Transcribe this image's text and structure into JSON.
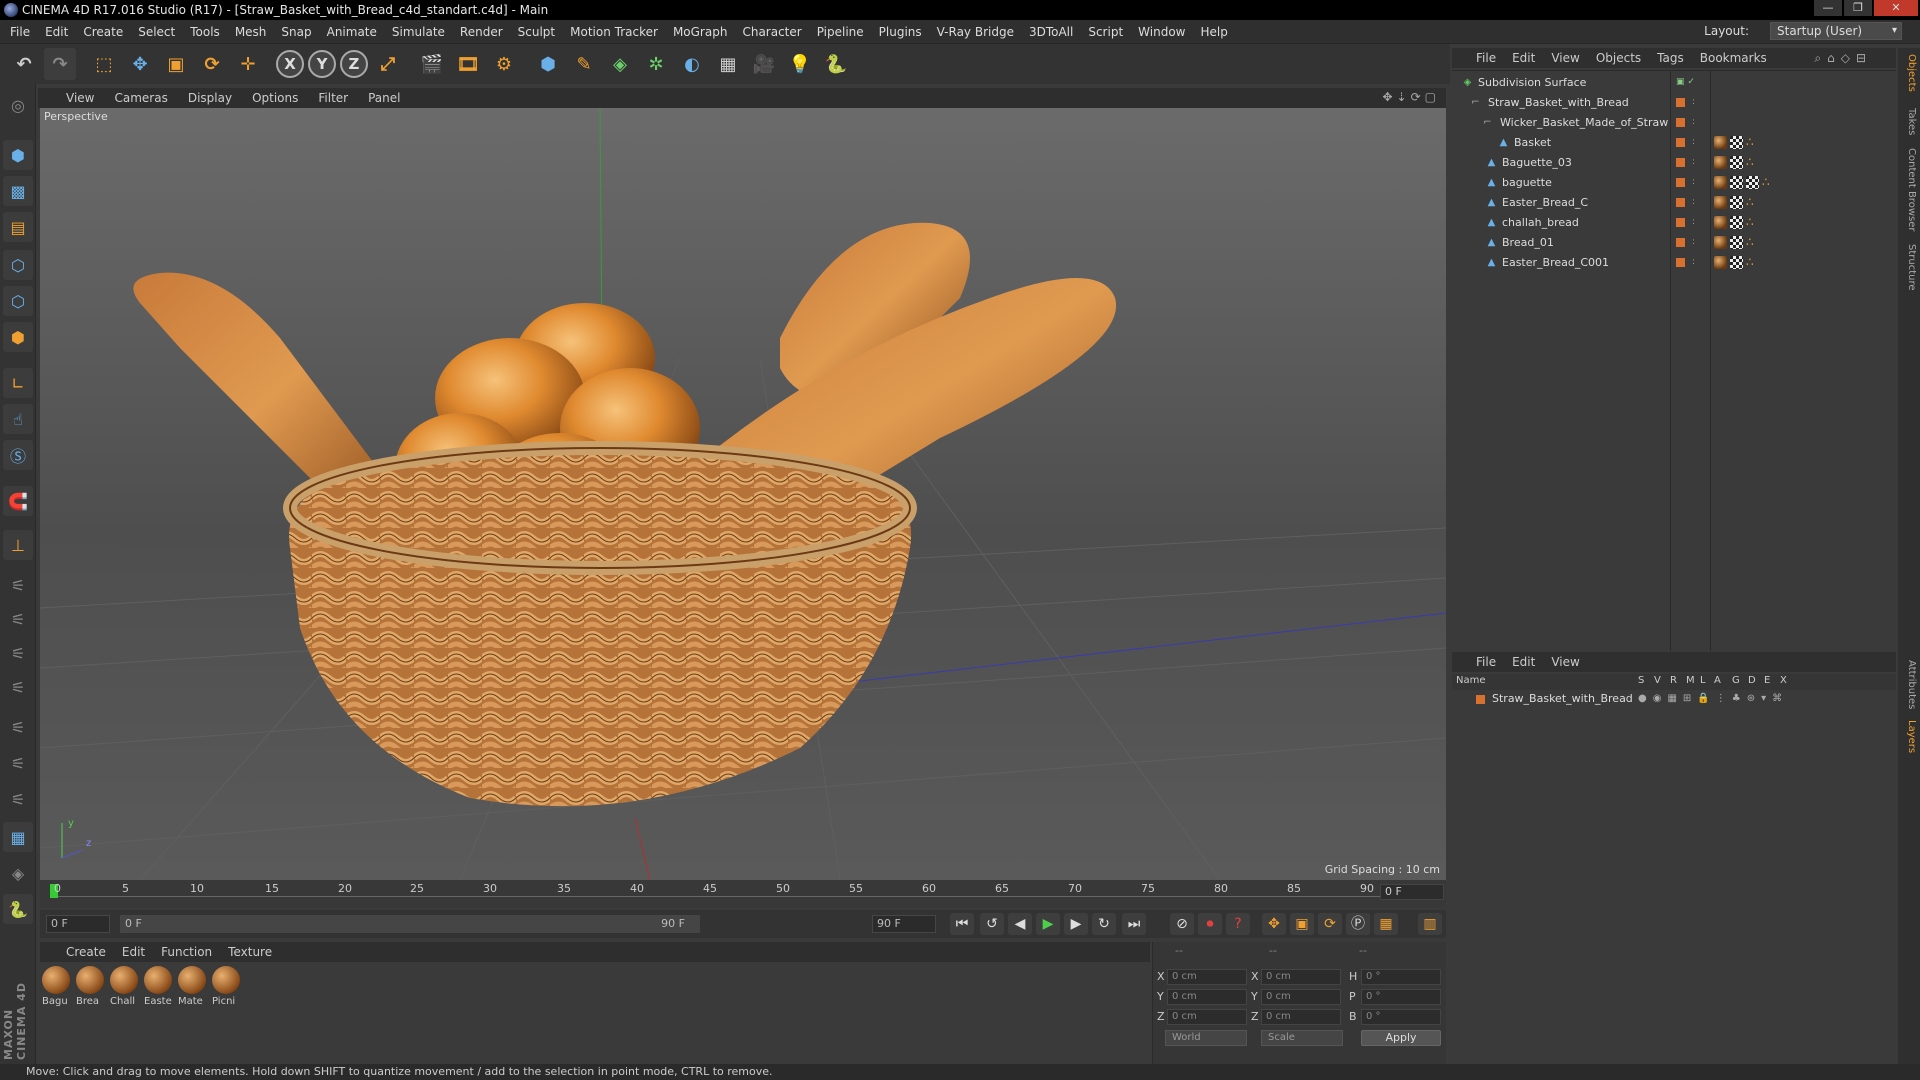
{
  "window": {
    "title": "CINEMA 4D R17.016 Studio (R17) - [Straw_Basket_with_Bread_c4d_standart.c4d] - Main",
    "min": "—",
    "max": "❐",
    "close": "✕"
  },
  "menu": [
    "File",
    "Edit",
    "Create",
    "Select",
    "Tools",
    "Mesh",
    "Snap",
    "Animate",
    "Simulate",
    "Render",
    "Sculpt",
    "Motion Tracker",
    "MoGraph",
    "Character",
    "Pipeline",
    "Plugins",
    "V-Ray Bridge",
    "3DToAll",
    "Script",
    "Window",
    "Help"
  ],
  "layout": {
    "label": "Layout:",
    "value": "Startup (User)"
  },
  "toolbar": {
    "axis_x": "X",
    "axis_y": "Y",
    "axis_z": "Z"
  },
  "viewport": {
    "menu": [
      "View",
      "Cameras",
      "Display",
      "Options",
      "Filter",
      "Panel"
    ],
    "label": "Perspective",
    "grid_spacing": "Grid Spacing : 10 cm",
    "axis_y": "y",
    "axis_z": "z"
  },
  "timeline": {
    "ticks": [
      "0",
      "5",
      "10",
      "15",
      "20",
      "25",
      "30",
      "35",
      "40",
      "45",
      "50",
      "55",
      "60",
      "65",
      "70",
      "75",
      "80",
      "85",
      "90"
    ],
    "current_frame": "0 F"
  },
  "transport": {
    "start_frame": "0 F",
    "range_start": "0 F",
    "range_end": "90 F",
    "end_frame": "90 F"
  },
  "material_manager": {
    "menu": [
      "Create",
      "Edit",
      "Function",
      "Texture"
    ],
    "materials": [
      "Bagu",
      "Brea",
      "Chall",
      "Easte",
      "Mate",
      "Picni"
    ]
  },
  "coordinates": {
    "headers": [
      "--",
      "--",
      "--"
    ],
    "rows": [
      {
        "l1": "X",
        "v1": "0 cm",
        "l2": "X",
        "v2": "0 cm",
        "l3": "H",
        "v3": "0 °"
      },
      {
        "l1": "Y",
        "v1": "0 cm",
        "l2": "Y",
        "v2": "0 cm",
        "l3": "P",
        "v3": "0 °"
      },
      {
        "l1": "Z",
        "v1": "0 cm",
        "l2": "Z",
        "v2": "0 cm",
        "l3": "B",
        "v3": "0 °"
      }
    ],
    "space": "World",
    "mode": "Scale",
    "apply": "Apply"
  },
  "object_manager": {
    "menu": [
      "File",
      "Edit",
      "View",
      "Objects",
      "Tags",
      "Bookmarks"
    ],
    "objects": [
      {
        "name": "Subdivision Surface",
        "indent": 0
      },
      {
        "name": "Straw_Basket_with_Bread",
        "indent": 1
      },
      {
        "name": "Wicker_Basket_Made_of_Straw",
        "indent": 2
      },
      {
        "name": "Basket",
        "indent": 3
      },
      {
        "name": "Baguette_03",
        "indent": 2
      },
      {
        "name": "baguette",
        "indent": 2
      },
      {
        "name": "Easter_Bread_C",
        "indent": 2
      },
      {
        "name": "challah_bread",
        "indent": 2
      },
      {
        "name": "Bread_01",
        "indent": 2
      },
      {
        "name": "Easter_Bread_C001",
        "indent": 2
      }
    ]
  },
  "layer_manager": {
    "menu": [
      "File",
      "Edit",
      "View"
    ],
    "columns": [
      "Name",
      "S",
      "V",
      "R",
      "M",
      "L",
      "A",
      "G",
      "D",
      "E",
      "X"
    ],
    "layers": [
      "Straw_Basket_with_Bread"
    ]
  },
  "right_tabs": [
    "Objects",
    "Takes",
    "Content Browser",
    "Structure",
    "Attributes",
    "Layers"
  ],
  "status": "Move: Click and drag to move elements. Hold down SHIFT to quantize movement / add to the selection in point mode, CTRL to remove.",
  "brand": "MAXON CINEMA 4D"
}
